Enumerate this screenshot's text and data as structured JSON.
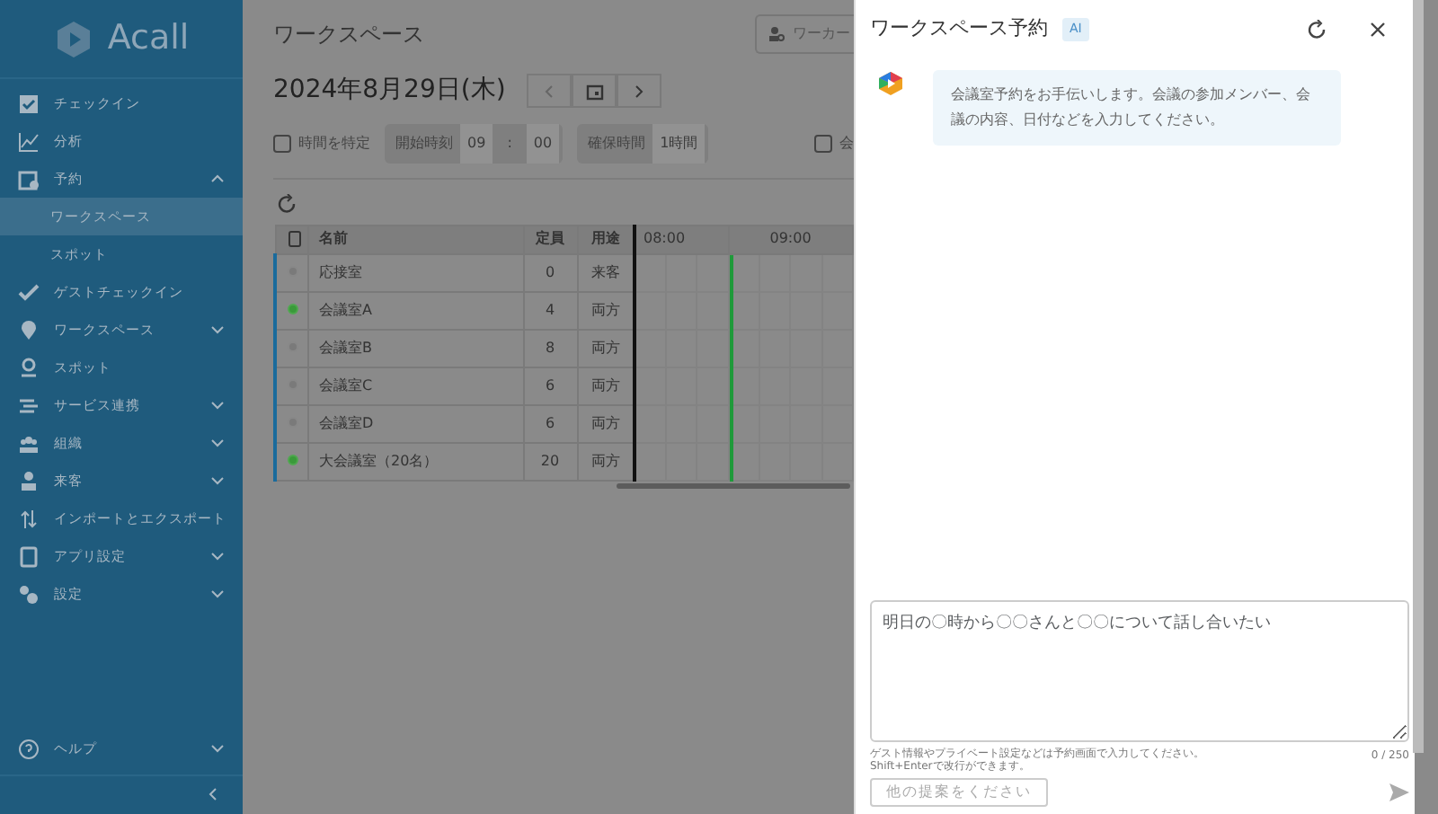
{
  "sidebar": {
    "logo": "Acall",
    "items": [
      {
        "label": "チェックイン"
      },
      {
        "label": "分析"
      },
      {
        "label": "予約",
        "expanded": true,
        "children": [
          {
            "label": "ワークスペース",
            "selected": true
          },
          {
            "label": "スポット",
            "selected": false
          }
        ]
      },
      {
        "label": "ゲストチェックイン"
      },
      {
        "label": "ワークスペース",
        "expanded": false
      },
      {
        "label": "スポット"
      },
      {
        "label": "サービス連携",
        "expanded": false
      },
      {
        "label": "組織",
        "expanded": false
      },
      {
        "label": "来客",
        "expanded": false
      },
      {
        "label": "インポートとエクスポート"
      },
      {
        "label": "アプリ設定",
        "expanded": false
      },
      {
        "label": "設定",
        "expanded": false
      }
    ],
    "footer_items": [
      {
        "label": "ヘルプ",
        "expanded": false
      }
    ]
  },
  "main": {
    "title": "ワークスペース",
    "search": {
      "placeholder": "ワーカー"
    },
    "date": "2024年8月29日(木)",
    "filters": {
      "specify_time": {
        "label": "時間を特定",
        "checked": false
      },
      "start_label": "開始時刻",
      "hour": "09",
      "separator": ":",
      "minute": "00",
      "duration_label": "確保時間",
      "duration": "1時間",
      "checkbox_2": {
        "label": "会",
        "checked": false
      }
    },
    "table": {
      "columns": [
        "名前",
        "定員",
        "用途"
      ],
      "time_slots": [
        "08:00",
        "09:00"
      ],
      "rows": [
        {
          "available": false,
          "name": "応接室",
          "capacity": "0",
          "usage": "来客"
        },
        {
          "available": true,
          "name": "会議室A",
          "capacity": "4",
          "usage": "両方"
        },
        {
          "available": false,
          "name": "会議室B",
          "capacity": "8",
          "usage": "両方"
        },
        {
          "available": false,
          "name": "会議室C",
          "capacity": "6",
          "usage": "両方"
        },
        {
          "available": false,
          "name": "会議室D",
          "capacity": "6",
          "usage": "両方"
        },
        {
          "available": true,
          "name": "大会議室（20名）",
          "capacity": "20",
          "usage": "両方"
        }
      ]
    }
  },
  "panel": {
    "title": "ワークスペース予約",
    "badge": "AI",
    "message": "会議室予約をお手伝いします。会議の参加メンバー、会議の内容、日付などを入力してください。",
    "input": {
      "placeholder": "明日の〇時から〇〇さんと〇〇について話し合いたい"
    },
    "hints": [
      "ゲスト情報やプライベート設定などは予約画面で入力してください。",
      "Shift+Enterで改行ができます。"
    ],
    "counter": "0 / 250",
    "suggest_button": {
      "label": "他の提案をください",
      "disabled": true
    }
  }
}
